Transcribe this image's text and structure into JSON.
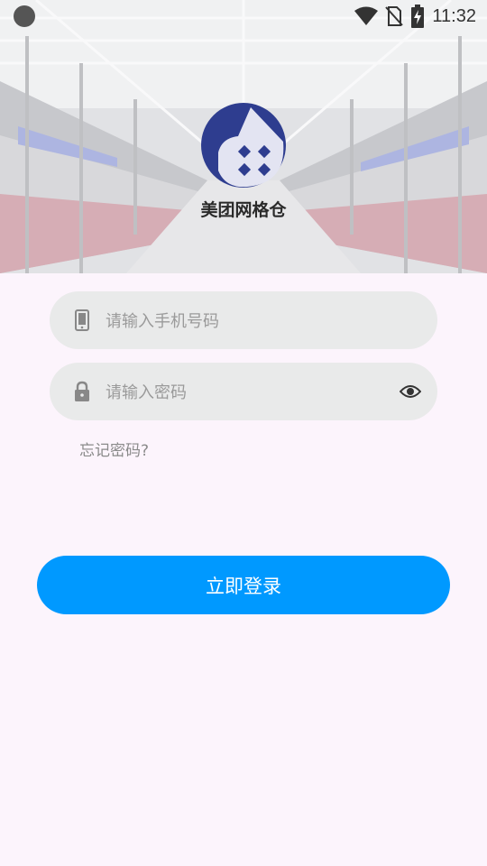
{
  "status_bar": {
    "time": "11:32",
    "icons": [
      "camera-dot-icon",
      "wifi-icon",
      "no-sim-icon",
      "battery-charging-icon"
    ]
  },
  "header": {
    "app_name": "美团网格仓",
    "logo_icon": "meituan-grid-warehouse-logo",
    "background": "warehouse-photo"
  },
  "form": {
    "phone": {
      "placeholder": "请输入手机号码",
      "value": "",
      "icon": "phone-icon"
    },
    "password": {
      "placeholder": "请输入密码",
      "value": "",
      "icon": "lock-icon",
      "toggle_icon": "eye-icon"
    },
    "forgot_label": "忘记密码?",
    "login_label": "立即登录"
  },
  "colors": {
    "primary": "#0099ff",
    "logo_blue": "#2e3d8f",
    "field_bg": "#e9eaea",
    "page_bg": "#fcf4fc"
  }
}
